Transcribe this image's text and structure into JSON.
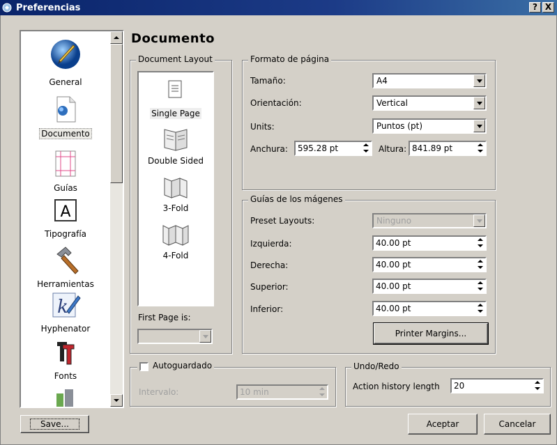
{
  "window": {
    "title": "Preferencias",
    "help_btn": "?",
    "close_btn": "X"
  },
  "sidebar": {
    "items": [
      {
        "label": "General",
        "icon": "general-icon"
      },
      {
        "label": "Documento",
        "icon": "document-icon",
        "selected": true
      },
      {
        "label": "Guías",
        "icon": "guides-icon"
      },
      {
        "label": "Tipografía",
        "icon": "typography-icon"
      },
      {
        "label": "Herramientas",
        "icon": "tools-icon"
      },
      {
        "label": "Hyphenator",
        "icon": "hyphenator-icon"
      },
      {
        "label": "Fonts",
        "icon": "fonts-icon"
      }
    ]
  },
  "section_title": "Documento",
  "document_layout": {
    "legend": "Document Layout",
    "items": [
      {
        "label": "Single Page",
        "selected": true
      },
      {
        "label": "Double Sided"
      },
      {
        "label": "3-Fold"
      },
      {
        "label": "4-Fold"
      }
    ],
    "first_page_label": "First Page is:",
    "first_page_value": ""
  },
  "formato": {
    "legend": "Formato de página",
    "tamano_label": "Tamaño:",
    "tamano_value": "A4",
    "orientacion_label": "Orientación:",
    "orientacion_value": "Vertical",
    "units_label": "Units:",
    "units_value": "Puntos (pt)",
    "anchura_label": "Anchura:",
    "anchura_value": "595.28 pt",
    "altura_label": "Altura:",
    "altura_value": "841.89 pt"
  },
  "guias": {
    "legend": "Guías de los mágenes",
    "preset_label": "Preset Layouts:",
    "preset_value": "Ninguno",
    "izquierda_label": "Izquierda:",
    "izquierda_value": "40.00 pt",
    "derecha_label": "Derecha:",
    "derecha_value": "40.00 pt",
    "superior_label": "Superior:",
    "superior_value": "40.00 pt",
    "inferior_label": "Inferior:",
    "inferior_value": "40.00 pt",
    "printer_margins_btn": "Printer Margins..."
  },
  "autosave": {
    "legend": "Autoguardado",
    "intervalo_label": "Intervalo:",
    "intervalo_value": "10 min"
  },
  "undo": {
    "legend": "Undo/Redo",
    "history_label": "Action history length",
    "history_value": "20"
  },
  "footer": {
    "save_btn": "Save...",
    "aceptar_btn": "Aceptar",
    "cancelar_btn": "Cancelar"
  }
}
